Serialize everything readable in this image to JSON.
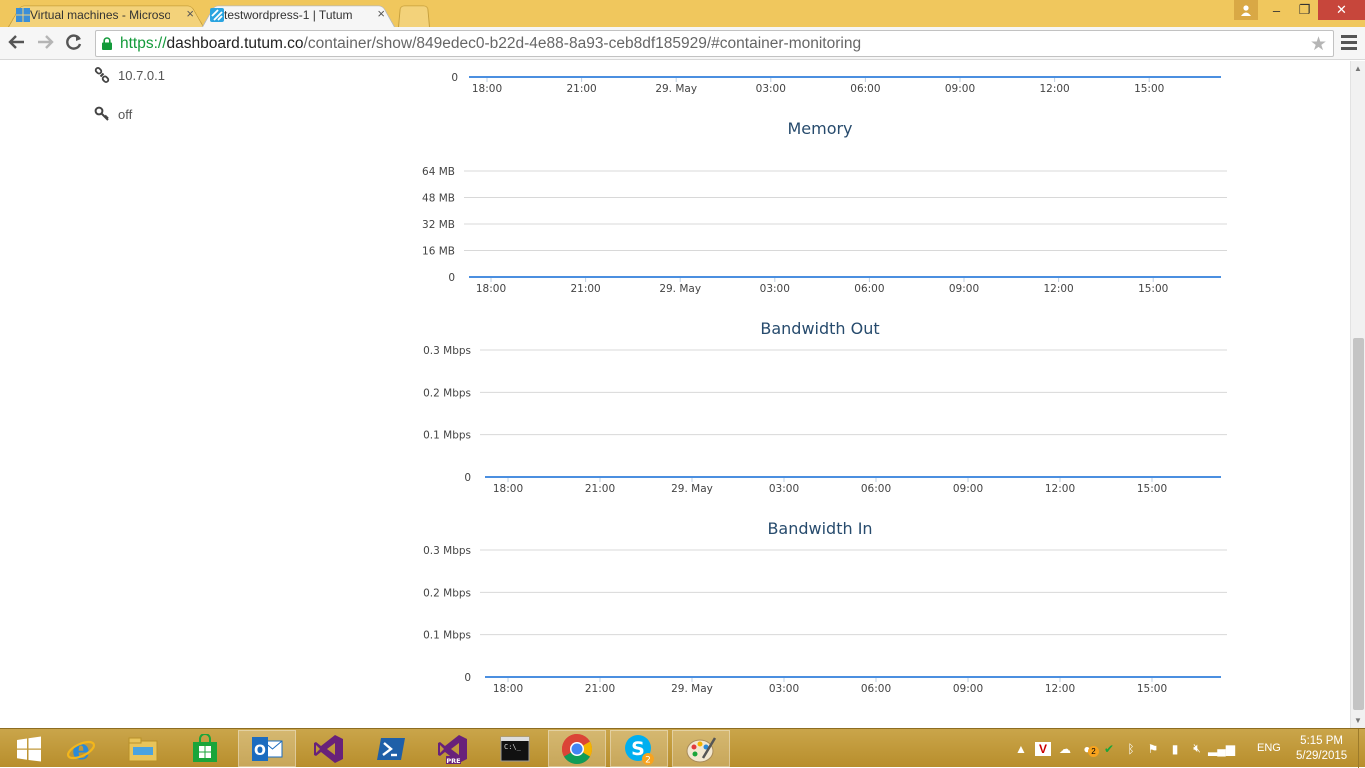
{
  "browser": {
    "tabs": [
      {
        "label": "Virtual machines - Microsoft Azure",
        "icon": "windows-logo-icon",
        "active": false
      },
      {
        "label": "testwordpress-1 | Tutum",
        "icon": "tutum-logo-icon",
        "active": true
      }
    ],
    "close_glyph": "×",
    "url": {
      "scheme": "https://",
      "host": "dashboard.tutum.co",
      "path": "/container/show/849edec0-b22d-4e88-8a93-ceb8df185929/#container-monitoring"
    },
    "window_controls": {
      "minimize": "–",
      "maximize": "❐",
      "close": "✕"
    }
  },
  "sidebar": {
    "items": [
      {
        "value": "10.7.0.1",
        "icon": "link-icon"
      },
      {
        "value": "off",
        "icon": "key-icon"
      }
    ]
  },
  "chart_data": [
    {
      "type": "line",
      "title": "",
      "categories": [
        "18:00",
        "21:00",
        "29. May",
        "03:00",
        "06:00",
        "09:00",
        "12:00",
        "15:00"
      ],
      "yticks": [
        "0"
      ],
      "series": [
        {
          "values": [
            0,
            0,
            0,
            0,
            0,
            0,
            0,
            0
          ]
        }
      ],
      "note_visible": "partial chart, only bottom axis visible"
    },
    {
      "type": "line",
      "title": "Memory",
      "categories": [
        "18:00",
        "21:00",
        "29. May",
        "03:00",
        "06:00",
        "09:00",
        "12:00",
        "15:00"
      ],
      "yticks": [
        "0",
        "16 MB",
        "32 MB",
        "48 MB",
        "64 MB"
      ],
      "ylim": [
        0,
        64
      ],
      "series": [
        {
          "values": [
            0,
            0,
            0,
            0,
            0,
            0,
            0,
            0
          ]
        }
      ]
    },
    {
      "type": "line",
      "title": "Bandwidth Out",
      "categories": [
        "18:00",
        "21:00",
        "29. May",
        "03:00",
        "06:00",
        "09:00",
        "12:00",
        "15:00"
      ],
      "yticks": [
        "0",
        "0.1 Mbps",
        "0.2 Mbps",
        "0.3 Mbps"
      ],
      "ylim": [
        0,
        0.3
      ],
      "series": [
        {
          "values": [
            0,
            0,
            0,
            0,
            0,
            0,
            0,
            0
          ]
        }
      ]
    },
    {
      "type": "line",
      "title": "Bandwidth In",
      "categories": [
        "18:00",
        "21:00",
        "29. May",
        "03:00",
        "06:00",
        "09:00",
        "12:00",
        "15:00"
      ],
      "yticks": [
        "0",
        "0.1 Mbps",
        "0.2 Mbps",
        "0.3 Mbps"
      ],
      "ylim": [
        0,
        0.3
      ],
      "series": [
        {
          "values": [
            0,
            0,
            0,
            0,
            0,
            0,
            0,
            0
          ]
        }
      ]
    }
  ],
  "taskbar": {
    "apps": [
      {
        "name": "start-icon",
        "active": false
      },
      {
        "name": "internet-explorer-icon",
        "active": false
      },
      {
        "name": "file-explorer-icon",
        "active": false
      },
      {
        "name": "windows-store-icon",
        "active": false
      },
      {
        "name": "outlook-icon",
        "active": true
      },
      {
        "name": "visual-studio-icon",
        "active": false
      },
      {
        "name": "powershell-icon",
        "active": false
      },
      {
        "name": "visual-studio-preview-icon",
        "active": false,
        "badge": "PRE"
      },
      {
        "name": "command-prompt-icon",
        "active": false
      },
      {
        "name": "chrome-icon",
        "active": true
      },
      {
        "name": "skype-icon",
        "active": true,
        "badge": "2"
      },
      {
        "name": "paint-icon",
        "active": true
      }
    ],
    "tray_badge": "2",
    "language": "ENG",
    "time": "5:15 PM",
    "date": "5/29/2015"
  },
  "colors": {
    "titlebar": "#f0c75d",
    "series_line": "#4b8fe0",
    "chart_title": "#274b6d",
    "taskbar": "#c29b3c"
  }
}
